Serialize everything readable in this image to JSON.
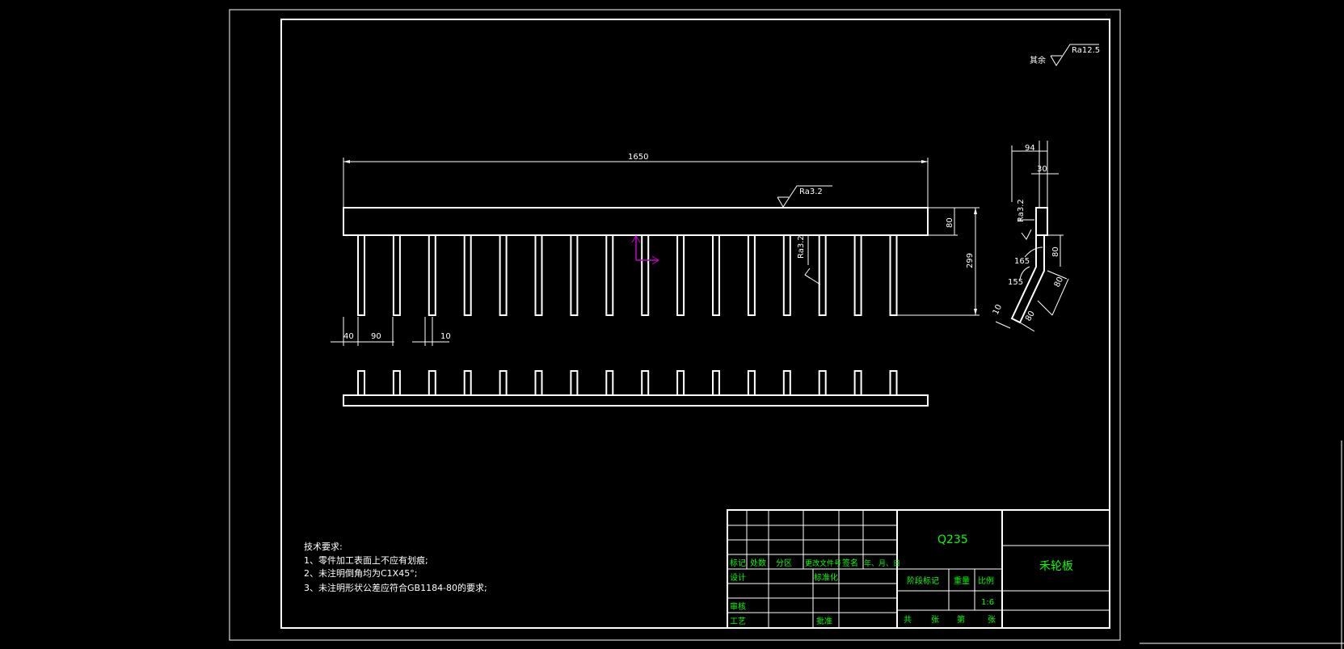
{
  "drawing": {
    "roughness_note": {
      "prefix": "其余",
      "value": "Ra12.5"
    },
    "front_view": {
      "overall_length": "1650",
      "surface_finish_top": "Ra3.2",
      "surface_finish_side": "Ra3.2",
      "bar_height": "80",
      "total_height": "299",
      "first_tine_offset": "40",
      "tine_pitch": "90",
      "tine_width": "10",
      "tine_count": 16
    },
    "side_view": {
      "width_total": "94",
      "width_top": "30",
      "surface_finish": "Ra3.2",
      "seg1": "80",
      "seg2": "80",
      "seg3": "80",
      "thickness": "10",
      "angle1": "165",
      "angle2": "155"
    },
    "technical_requirements": {
      "title": "技术要求:",
      "items": [
        "1、零件加工表面上不应有划痕;",
        "2、未注明倒角均为C1X45°;",
        "3、未注明形状公差应符合GB1184-80的要求;"
      ]
    },
    "title_block": {
      "material": "Q235",
      "part_name": "禾轮板",
      "revision_headers": [
        "标记",
        "处数",
        "分区",
        "更改文件号",
        "签名",
        "年、月、日"
      ],
      "design": "设计",
      "standardization": "标准化",
      "review": "审核",
      "process": "工艺",
      "approval": "批准",
      "stage_mark": "阶段标记",
      "weight": "重量",
      "scale": "比例",
      "scale_value": "1:6",
      "sheets_total": "共",
      "sheets_label1": "张",
      "sheet_no": "第",
      "sheets_label2": "张"
    }
  }
}
